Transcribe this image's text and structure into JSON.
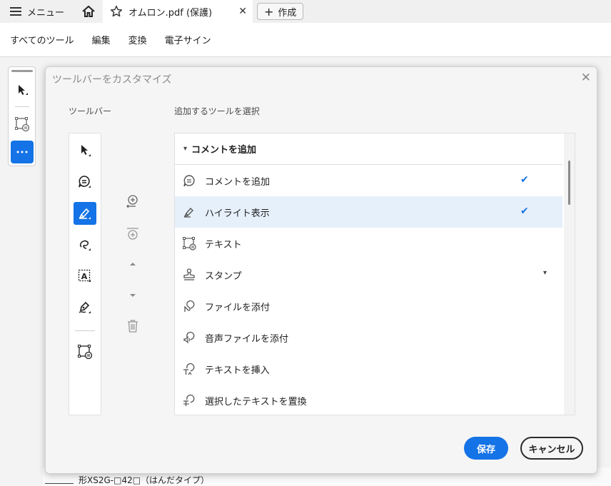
{
  "tabbar": {
    "menu_label": "メニュー",
    "doc_tab_title": "オムロン.pdf (保護)",
    "close_glyph": "✕",
    "create_label": "作成",
    "create_plus": "+"
  },
  "menubar": {
    "items": [
      "すべてのツール",
      "編集",
      "変換",
      "電子サイン"
    ]
  },
  "background_doc": {
    "text": "形XS2G-□42□（はんだタイプ）"
  },
  "dialog": {
    "title": "ツールバーをカスタマイズ",
    "close_glyph": "✕",
    "toolbar_label": "ツールバー",
    "select_label": "追加するツールを選択",
    "group_header": "コメントを追加",
    "group_caret": "▾",
    "rows": [
      {
        "label": "コメントを追加",
        "icon": "comment-icon",
        "checked": "✔"
      },
      {
        "label": "ハイライト表示",
        "icon": "highlight-icon",
        "checked": "✔"
      },
      {
        "label": "テキスト",
        "icon": "textbox-icon",
        "checked": ""
      },
      {
        "label": "スタンプ",
        "icon": "stamp-icon",
        "checked": "",
        "caret": "▾"
      },
      {
        "label": "ファイルを添付",
        "icon": "attach-file-icon",
        "checked": ""
      },
      {
        "label": "音声ファイルを添付",
        "icon": "attach-audio-icon",
        "checked": ""
      },
      {
        "label": "テキストを挿入",
        "icon": "insert-text-icon",
        "checked": ""
      },
      {
        "label": "選択したテキストを置換",
        "icon": "replace-text-icon",
        "checked": ""
      }
    ],
    "save_label": "保存",
    "cancel_label": "キャンセル"
  },
  "colors": {
    "accent": "#1473e6",
    "highlight_row": "#e6f0fb"
  }
}
